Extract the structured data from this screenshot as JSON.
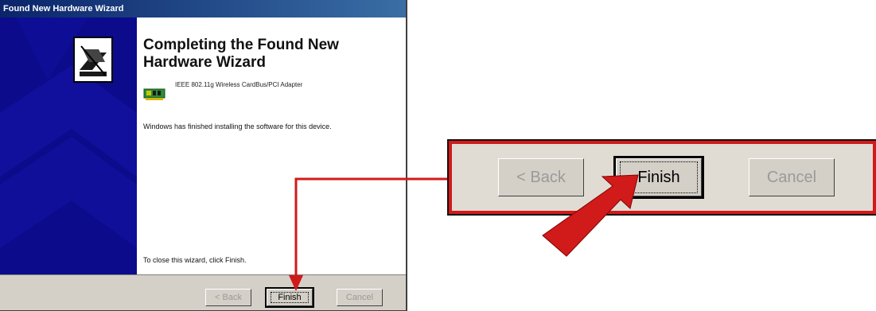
{
  "window": {
    "title": "Found New Hardware Wizard",
    "heading": "Completing the Found New Hardware Wizard",
    "device_name": "IEEE 802.11g Wireless CardBus/PCI Adapter",
    "finished_message": "Windows has finished installing the software for this device.",
    "close_instruction": "To close this wizard, click Finish."
  },
  "buttons_small": {
    "back": "< Back",
    "finish": "Finish",
    "cancel": "Cancel"
  },
  "callout": {
    "back": "< Back",
    "finish": "Finish",
    "cancel": "Cancel"
  },
  "colors": {
    "accent_red": "#d11a1a",
    "sidebar_blue": "#0b0b8c",
    "dialog_gray": "#d4d0c8"
  },
  "icons": [
    "wizard-icon",
    "network-card-icon",
    "red-arrow-icon"
  ]
}
